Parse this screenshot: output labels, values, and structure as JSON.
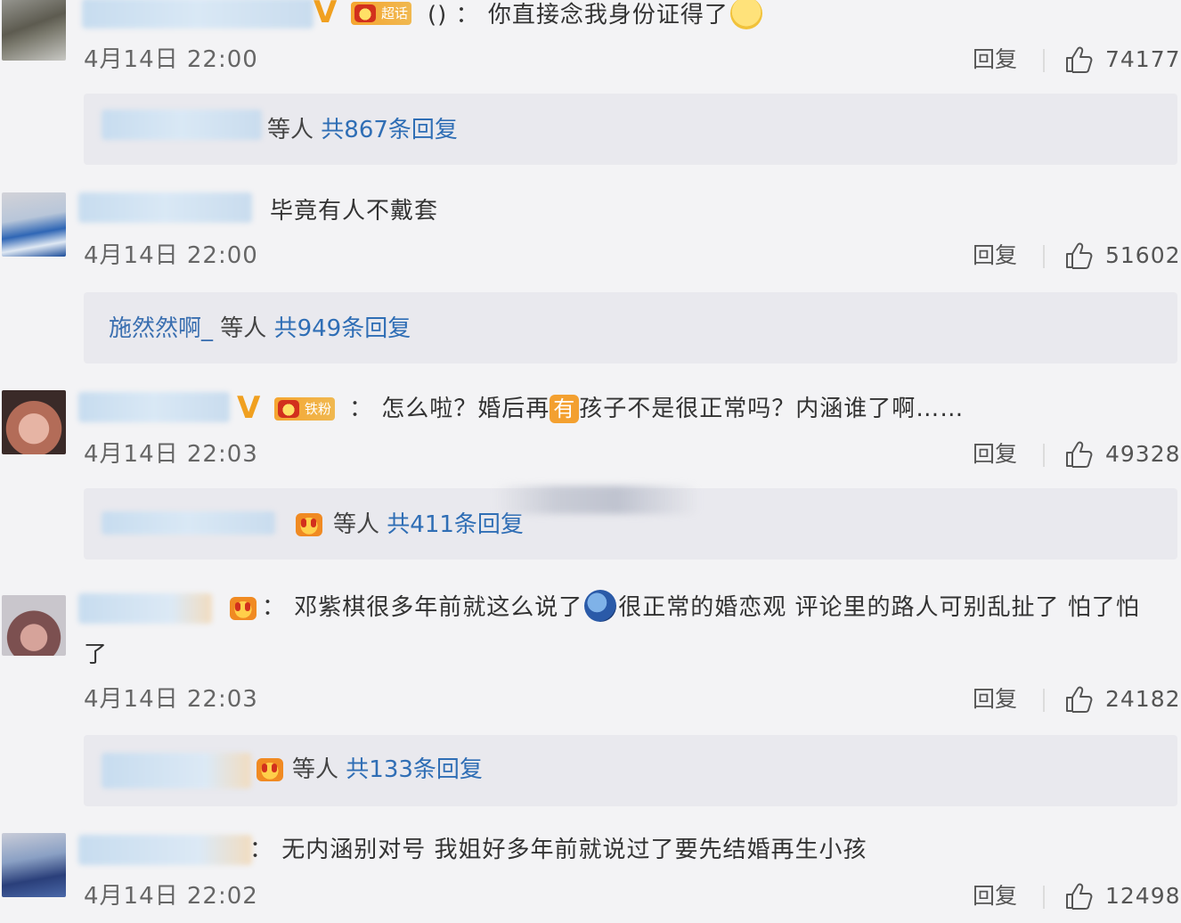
{
  "comments": [
    {
      "time": "4月14日 22:00",
      "reply": "回复",
      "likes": "74177",
      "text_pre": "()  ：  你直接念我身份证得了",
      "sub": {
        "who": "等人",
        "count": "共867条回复"
      }
    },
    {
      "time": "4月14日 22:00",
      "reply": "回复",
      "likes": "51602",
      "text": "毕竟有人不戴套",
      "sub": {
        "user": "施然然啊_",
        "who": "等人",
        "count": "共949条回复"
      }
    },
    {
      "time": "4月14日 22:03",
      "reply": "回复",
      "likes": "49328",
      "text_a": "：  怎么啦？婚后再",
      "highlight": "有",
      "text_b": "孩子不是很正常吗？内涵谁了啊……",
      "sub": {
        "who": "等人",
        "count": "共411条回复"
      }
    },
    {
      "time": "4月14日 22:03",
      "reply": "回复",
      "likes": "24182",
      "text_a": "：  邓紫棋很多年前就这么说了",
      "text_b": "很正常的婚恋观 评论里的路人可别乱扯了 怕了怕",
      "text_c": "了",
      "sub": {
        "who": "等人",
        "count": "共133条回复"
      }
    },
    {
      "time": "4月14日 22:02",
      "reply": "回复",
      "likes": "12498",
      "text": "：  无内涵别对号 我姐好多年前就说过了要先结婚再生小孩"
    }
  ],
  "badges": {
    "level_label_1": "超话",
    "level_label_2": "铁粉"
  },
  "icons": {
    "like": "thumbs-up-icon",
    "verified": "v-badge-icon",
    "fan_crown": "crown-icon",
    "emoji_1": "doge-emoji-icon",
    "emoji_2": "shark-emoji-icon"
  },
  "colors": {
    "link": "#2f6eb5",
    "badge": "#f0a020",
    "background": "#f3f3f5"
  }
}
